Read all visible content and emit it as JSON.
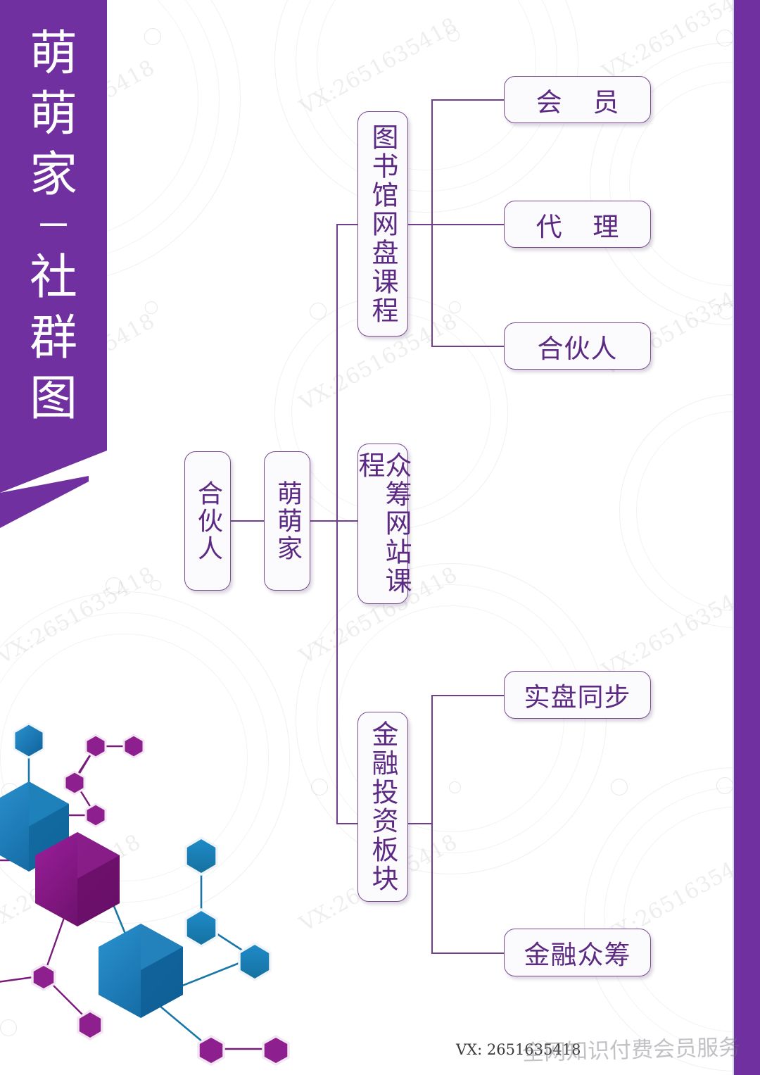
{
  "title_band": {
    "lines": [
      "萌",
      "萌",
      "家",
      "－",
      "社",
      "群",
      "图"
    ],
    "full_text": "萌萌家－社群图",
    "bg_color": "#7030a0",
    "text_color": "#ffffff"
  },
  "diagram": {
    "type": "org-tree",
    "root": "萌萌家",
    "nodes": {
      "partner_left": "合伙人",
      "center": "萌萌家",
      "branch_1": "图书馆网盘课程",
      "branch_2": "众筹网站课程",
      "branch_3": "金融投资板块",
      "leaf_1_1": "会 员",
      "leaf_1_2": "代 理",
      "leaf_1_3": "合伙人",
      "leaf_3_1": "实盘同步",
      "leaf_3_2": "金融众筹"
    },
    "edges": [
      [
        "合伙人",
        "萌萌家"
      ],
      [
        "萌萌家",
        "图书馆网盘课程"
      ],
      [
        "萌萌家",
        "众筹网站课程"
      ],
      [
        "萌萌家",
        "金融投资板块"
      ],
      [
        "图书馆网盘课程",
        "会 员"
      ],
      [
        "图书馆网盘课程",
        "代 理"
      ],
      [
        "图书馆网盘课程",
        "合伙人"
      ],
      [
        "金融投资板块",
        "实盘同步"
      ],
      [
        "金融投资板块",
        "金融众筹"
      ]
    ],
    "node_border_color": "#7a4b93",
    "node_text_color": "#5c2a83",
    "connector_color": "#6f3f8c"
  },
  "watermark": {
    "text": "VX:2651635418",
    "color": "#787882",
    "angle_deg": -29
  },
  "footer": {
    "vx_text": "VX: 2651635418",
    "overlay_text": "全网知识付费会员服务"
  },
  "decor": {
    "molecule_purple": "#8e1f8e",
    "molecule_purple_dark": "#6b0f6b",
    "molecule_blue": "#1b84c4",
    "molecule_blue_dark": "#1166a0",
    "right_strip_color": "#7030a0"
  }
}
